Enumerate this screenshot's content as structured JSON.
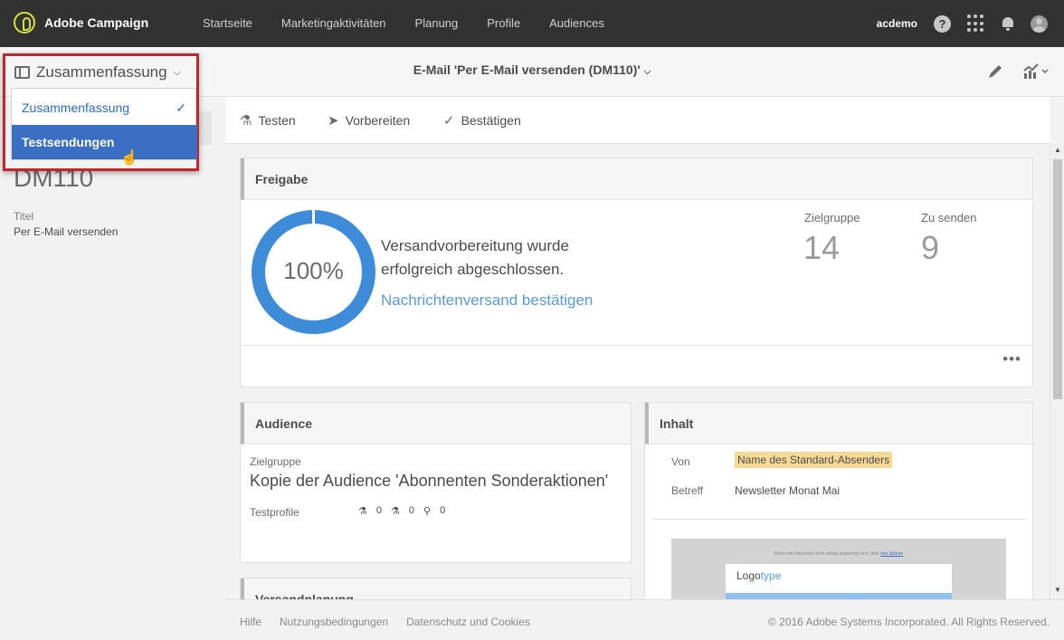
{
  "app": {
    "name": "Adobe Campaign"
  },
  "nav": {
    "items": [
      "Startseite",
      "Marketingaktivitäten",
      "Planung",
      "Profile",
      "Audiences"
    ]
  },
  "user": {
    "name": "acdemo",
    "help": "?"
  },
  "header": {
    "title": "E-Mail 'Per E-Mail versenden (DM110)'"
  },
  "view_switch": {
    "label": "Zusammenfassung",
    "options": [
      {
        "label": "Zusammenfassung",
        "selected": true
      },
      {
        "label": "Testsendungen",
        "hovered": true
      }
    ]
  },
  "summary": {
    "code": "DM110",
    "title_label": "Titel",
    "title_value": "Per E-Mail versenden"
  },
  "toolbar": {
    "test": "Testen",
    "prepare": "Vorbereiten",
    "confirm": "Bestätigen"
  },
  "freigabe": {
    "title": "Freigabe",
    "progress_percent": 100,
    "progress_label": "100%",
    "status_line1": "Versandvorbereitung wurde",
    "status_line2": "erfolgreich abgeschlossen.",
    "link": "Nachrichtenversand bestätigen",
    "target_label": "Zielgruppe",
    "target_value": "14",
    "to_send_label": "Zu senden",
    "to_send_value": "9",
    "more": "•••"
  },
  "audience": {
    "title": "Audience",
    "target_label": "Zielgruppe",
    "target_value": "Kopie der Audience 'Abonnenten Sonderaktionen'",
    "test_profiles_label": "Testprofile",
    "counts": [
      "0",
      "0",
      "0"
    ]
  },
  "inhalt": {
    "title": "Inhalt",
    "from_label": "Von",
    "from_value": "Name des Standard-Absenders",
    "subject_label": "Betreff",
    "subject_value": "Newsletter Monat Mai",
    "preview_note": "Wenn die Nachricht nicht richtig angezeigt wird, bitte ",
    "preview_link": "hier klicken",
    "logo_a": "Logo",
    "logo_b": "type"
  },
  "versand": {
    "title": "Versandplanung"
  },
  "footer": {
    "links": [
      "Hilfe",
      "Nutzungsbedingungen",
      "Datenschutz und Cookies"
    ],
    "copyright": "© 2016 Adobe Systems Incorporated. All Rights Reserved."
  },
  "colors": {
    "accent": "#3b6fc4",
    "progress": "#3d8bd9",
    "frame": "#c0272d",
    "highlight": "#f5d995"
  }
}
